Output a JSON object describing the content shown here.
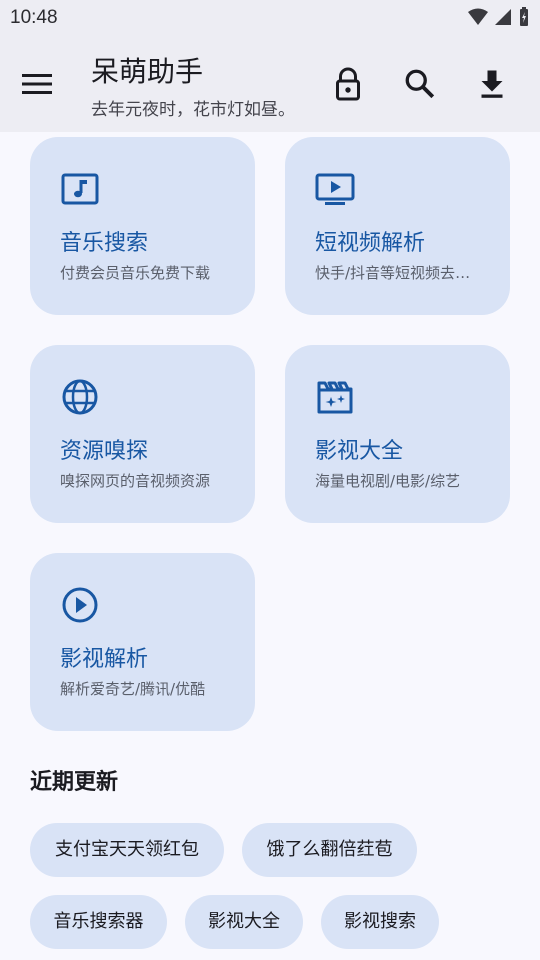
{
  "status": {
    "time": "10:48"
  },
  "app_bar": {
    "title": "呆萌助手",
    "subtitle": "去年元夜时，花市灯如昼。"
  },
  "cards": [
    {
      "title": "音乐搜索",
      "desc": "付费会员音乐免费下载",
      "icon": "music-note-icon"
    },
    {
      "title": "短视频解析",
      "desc": "快手/抖音等短视频去水印",
      "icon": "tv-play-icon"
    },
    {
      "title": "资源嗅探",
      "desc": "嗅探网页的音视频资源",
      "icon": "globe-icon"
    },
    {
      "title": "影视大全",
      "desc": "海量电视剧/电影/综艺",
      "icon": "movie-clapper-icon"
    },
    {
      "title": "影视解析",
      "desc": "解析爱奇艺/腾讯/优酷",
      "icon": "play-circle-icon"
    }
  ],
  "recent": {
    "title": "近期更新",
    "chips": [
      "支付宝天天领红包",
      "饿了么翻倍荭苞",
      "音乐搜索器",
      "影视大全",
      "影视搜索"
    ]
  },
  "colors": {
    "accent": "#1857a3",
    "card_bg": "#d9e3f6",
    "bar_bg": "#ededf3"
  }
}
